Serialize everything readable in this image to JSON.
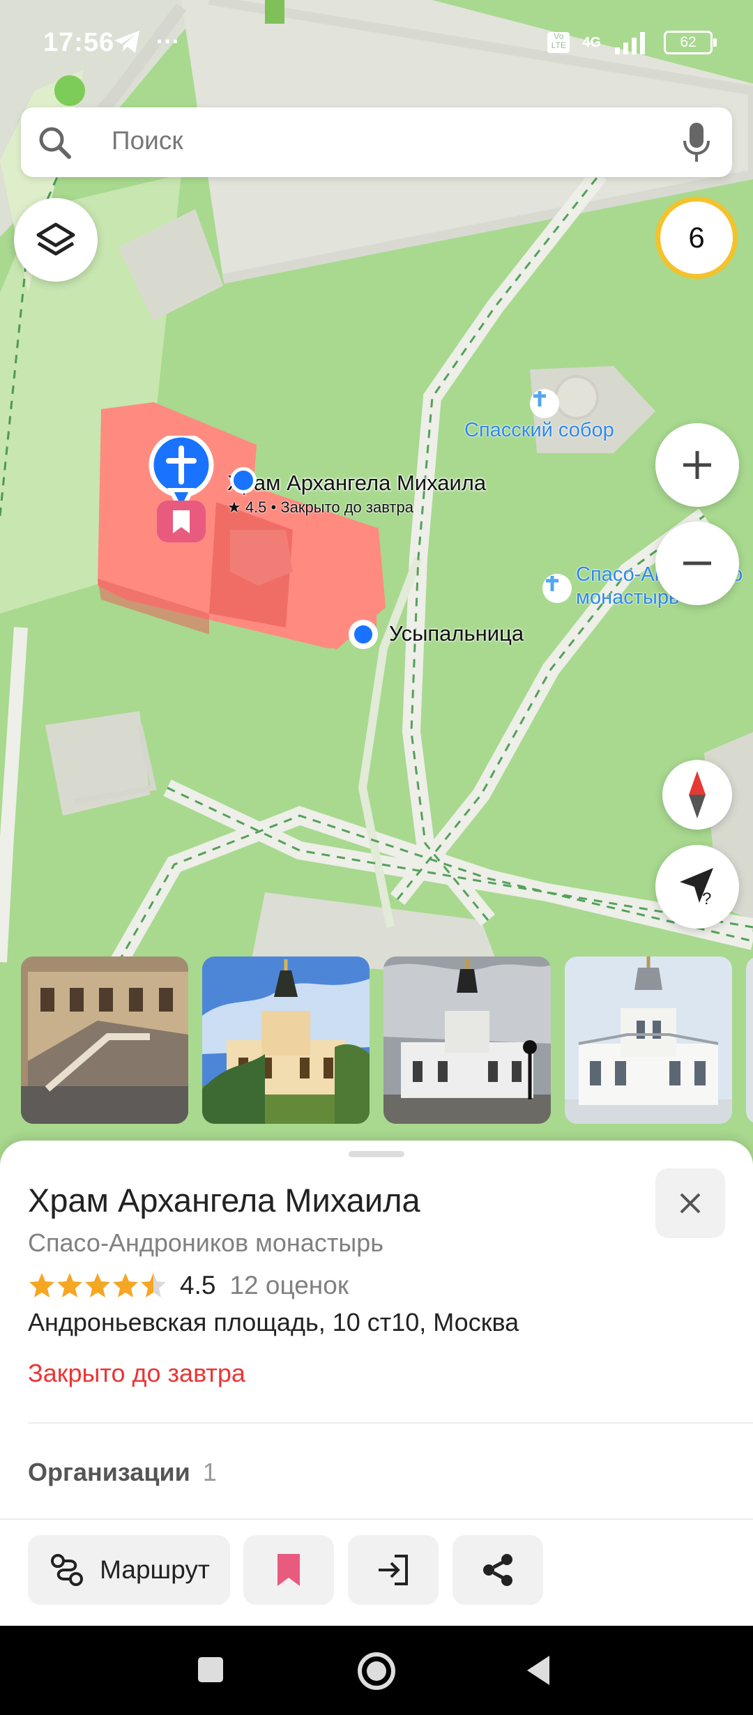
{
  "status_bar": {
    "time": "17:56",
    "extra": "···",
    "network": "4G",
    "battery": "62"
  },
  "search": {
    "placeholder": "Поиск"
  },
  "map": {
    "traffic_level": "6",
    "selected_place": {
      "name": "Храм Архангела Михаила",
      "meta": "★ 4.5 • Закрыто до завтра"
    },
    "labels": {
      "spassky": "Спасский собор",
      "monastery_line1": "Спасо-Андронико",
      "monastery_line2": "монастырь",
      "usypalnitsa": "Усыпальница"
    },
    "colors": {
      "building_selected": "#fa8a82",
      "grass": "#a8d98f",
      "path": "#e8e9e2",
      "pin": "#1a73ff",
      "bookmark": "#e85b7f"
    }
  },
  "place": {
    "title": "Храм Архангела Михаила",
    "subtitle": "Спасо-Андроников монастырь",
    "rating": "4.5",
    "rating_value": 4.5,
    "reviews": "12 оценок",
    "address": "Андроньевская площадь, 10 ст10, Москва",
    "status": "Закрыто до завтра",
    "orgs_label": "Организации",
    "orgs_count": "1"
  },
  "actions": {
    "route": "Маршрут",
    "save_icon": "bookmark-icon",
    "enter_icon": "enter-icon",
    "share_icon": "share-icon"
  },
  "nav_icons": [
    "square-icon",
    "circle-icon",
    "back-triangle-icon"
  ]
}
